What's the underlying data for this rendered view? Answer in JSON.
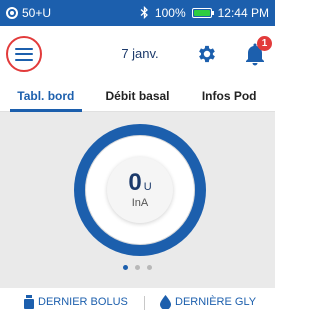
{
  "status_bar": {
    "pod_label": "50+U",
    "bluetooth_icon": "bluetooth-icon",
    "battery_percent": "100%",
    "battery_level": 1.0,
    "time": "12:44 PM",
    "colors": {
      "background": "#1c5fad",
      "battery": "#2ecc40"
    }
  },
  "header": {
    "menu_icon": "hamburger-menu-icon",
    "date": "7 janv.",
    "settings_icon": "gear-icon",
    "notifications_icon": "bell-icon",
    "notification_count": "1",
    "colors": {
      "highlight": "#e23b3b",
      "accent": "#1c5fad"
    }
  },
  "tabs": [
    {
      "label": "Tabl. bord",
      "active": true
    },
    {
      "label": "Débit basal",
      "active": false
    },
    {
      "label": "Infos Pod",
      "active": false
    }
  ],
  "dashboard": {
    "iob_value": "0",
    "iob_unit": "U",
    "iob_label": "InA",
    "page_count": 3,
    "active_page": 1
  },
  "bottom": {
    "last_bolus_label": "DERNIER BOLUS",
    "last_bolus_icon": "insulin-vial-icon",
    "last_glucose_label": "DERNIÈRE GLY",
    "last_glucose_icon": "blood-drop-icon"
  }
}
